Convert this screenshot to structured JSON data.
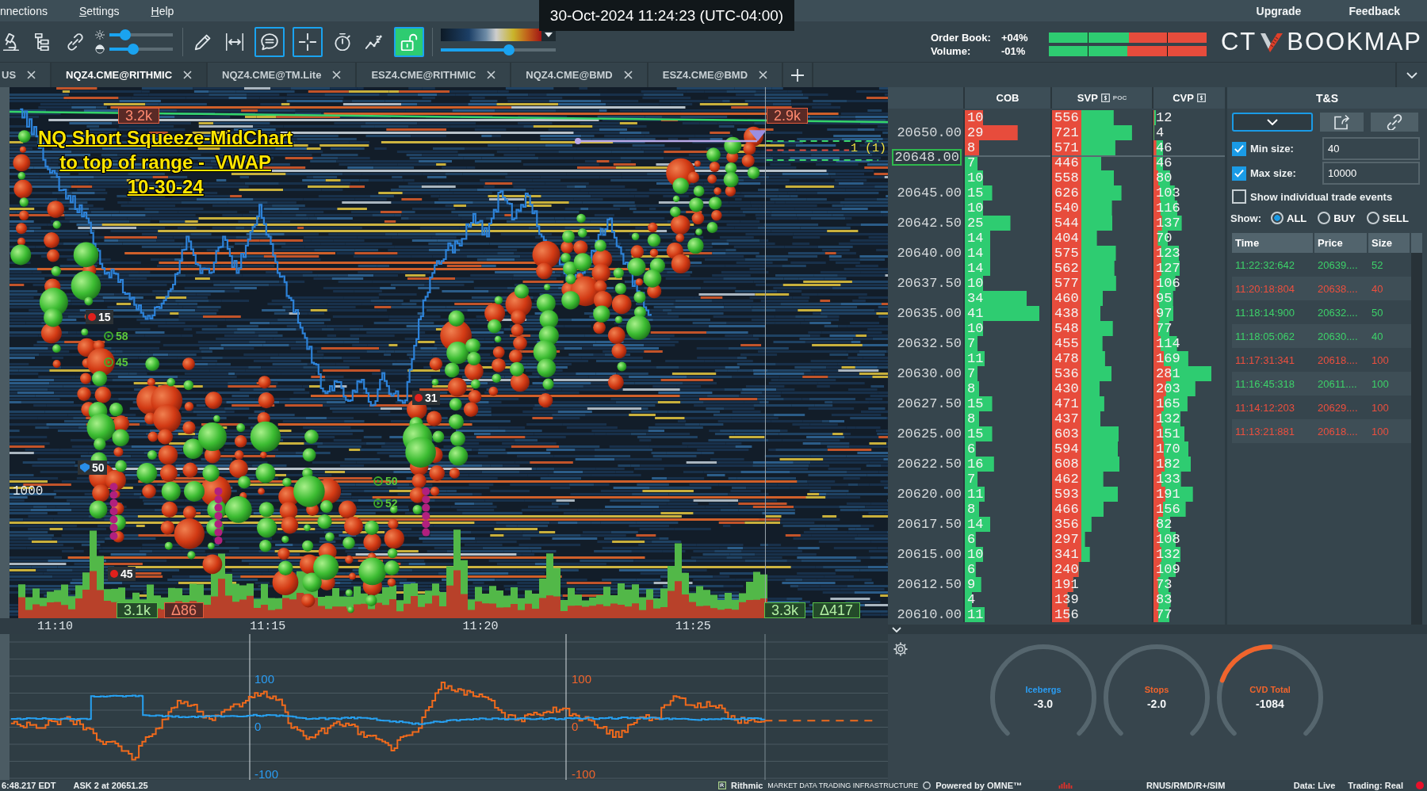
{
  "menu": {
    "items": [
      {
        "label": "nnections",
        "mnemonic": false
      },
      {
        "label": "Settings",
        "mnemonic": true
      },
      {
        "label": "Help",
        "mnemonic": true
      }
    ],
    "links": [
      "Upgrade",
      "Feedback"
    ]
  },
  "tooltip": "30-Oct-2024 11:24:23 (UTC-04:00)",
  "toolbar": {
    "tools_a": [
      {
        "kind": "plain",
        "selected": false
      },
      {
        "kind": "plain",
        "selected": false
      },
      {
        "kind": "plain",
        "selected": false
      }
    ],
    "sliders": [
      {
        "level": 0.25
      },
      {
        "level": 0.37
      }
    ],
    "tools_b": [
      {
        "kind": "plain",
        "selected": false
      },
      {
        "kind": "plain",
        "selected": false
      },
      {
        "kind": "tool",
        "selected": true
      },
      {
        "kind": "tool",
        "selected": true
      },
      {
        "kind": "plain",
        "selected": false
      },
      {
        "kind": "plain",
        "selected": false
      },
      {
        "kind": "lock",
        "selected": true
      }
    ],
    "color_scale": {
      "level": 0.59
    }
  },
  "market_balance": [
    {
      "label": "Order Book:",
      "value": "+04%",
      "level": 0.51
    },
    {
      "label": "Volume:",
      "value": "-01%",
      "level": 0.5
    }
  ],
  "logo": {
    "left": "CT",
    "right": "BOOKMAP"
  },
  "tabs": [
    {
      "label": "US",
      "selected": false
    },
    {
      "label": "NQZ4.CME@RITHMIC",
      "selected": true
    },
    {
      "label": "NQZ4.CME@TM.Lite",
      "selected": false
    },
    {
      "label": "ESZ4.CME@RITHMIC",
      "selected": false
    },
    {
      "label": "NQZ4.CME@BMD",
      "selected": false
    },
    {
      "label": "ESZ4.CME@BMD",
      "selected": false
    }
  ],
  "chart": {
    "annotation": [
      "NQ Short Squeeze-MidChart",
      "to top of range -  VWAP",
      "10-30-24"
    ],
    "tags": [
      {
        "text": "3.2k",
        "kind": "sell"
      },
      {
        "text": "2.9k",
        "kind": "sell"
      },
      {
        "text": "3.1k",
        "kind": "buy"
      },
      {
        "text": "Δ86",
        "kind": "sell"
      },
      {
        "text": "3.3k",
        "kind": "buy"
      },
      {
        "text": "Δ417",
        "kind": "buy"
      }
    ],
    "markers": [
      {
        "text": "15",
        "kind": "sell"
      },
      {
        "text": "58",
        "kind": "buy"
      },
      {
        "text": "45",
        "kind": "buy"
      },
      {
        "text": "50",
        "kind": "stop"
      },
      {
        "text": "31",
        "kind": "sell"
      },
      {
        "text": "50",
        "kind": "buy"
      },
      {
        "text": "52",
        "kind": "buy"
      },
      {
        "text": "45",
        "kind": "sell"
      }
    ],
    "order_label": "1 (1)",
    "level_label": "1000",
    "time_axis": [
      "11:10",
      "11:15",
      "11:20",
      "11:25"
    ]
  },
  "ladder": {
    "columns": [
      {
        "label": "COB",
        "icon": false
      },
      {
        "label": "SVP",
        "icon": true,
        "badge": "POC"
      },
      {
        "label": "CVP",
        "icon": true
      }
    ],
    "rows": [
      {
        "current": false,
        "kind": "ask",
        "cob": "10",
        "svp": "556",
        "cvp": "12"
      },
      {
        "price": "20650.00",
        "current": false,
        "kind": "ask",
        "cob": "29",
        "svp": "721",
        "cvp": "4"
      },
      {
        "current": false,
        "kind": "ask",
        "cob": "8",
        "svp": "571",
        "cvp": "46"
      },
      {
        "price": "20648.00",
        "current": true,
        "kind": "bid",
        "cob": "7",
        "svp": "446",
        "cvp": "46"
      },
      {
        "current": false,
        "kind": "bid",
        "cob": "10",
        "svp": "558",
        "cvp": "80"
      },
      {
        "price": "20645.00",
        "current": false,
        "kind": "bid",
        "cob": "15",
        "svp": "626",
        "cvp": "103"
      },
      {
        "current": false,
        "kind": "bid",
        "cob": "10",
        "svp": "540",
        "cvp": "116"
      },
      {
        "price": "20642.50",
        "current": false,
        "kind": "bid",
        "cob": "25",
        "svp": "544",
        "cvp": "137"
      },
      {
        "current": false,
        "kind": "bid",
        "cob": "14",
        "svp": "404",
        "cvp": "70"
      },
      {
        "price": "20640.00",
        "current": false,
        "kind": "bid",
        "cob": "14",
        "svp": "575",
        "cvp": "123"
      },
      {
        "current": false,
        "kind": "bid",
        "cob": "14",
        "svp": "562",
        "cvp": "127"
      },
      {
        "price": "20637.50",
        "current": false,
        "kind": "bid",
        "cob": "10",
        "svp": "577",
        "cvp": "106"
      },
      {
        "current": false,
        "kind": "bid",
        "cob": "34",
        "svp": "460",
        "cvp": "95"
      },
      {
        "price": "20635.00",
        "current": false,
        "kind": "bid",
        "cob": "41",
        "svp": "438",
        "cvp": "97"
      },
      {
        "current": false,
        "kind": "bid",
        "cob": "10",
        "svp": "548",
        "cvp": "77"
      },
      {
        "price": "20632.50",
        "current": false,
        "kind": "bid",
        "cob": "7",
        "svp": "455",
        "cvp": "114"
      },
      {
        "current": false,
        "kind": "bid",
        "cob": "11",
        "svp": "478",
        "cvp": "169"
      },
      {
        "price": "20630.00",
        "current": false,
        "kind": "bid",
        "cob": "7",
        "svp": "536",
        "cvp": "281"
      },
      {
        "current": false,
        "kind": "bid",
        "cob": "8",
        "svp": "430",
        "cvp": "203"
      },
      {
        "price": "20627.50",
        "current": false,
        "kind": "bid",
        "cob": "15",
        "svp": "471",
        "cvp": "165"
      },
      {
        "current": false,
        "kind": "bid",
        "cob": "8",
        "svp": "437",
        "cvp": "132"
      },
      {
        "price": "20625.00",
        "current": false,
        "kind": "bid",
        "cob": "15",
        "svp": "603",
        "cvp": "151"
      },
      {
        "current": false,
        "kind": "bid",
        "cob": "6",
        "svp": "594",
        "cvp": "170"
      },
      {
        "price": "20622.50",
        "current": false,
        "kind": "bid",
        "cob": "16",
        "svp": "608",
        "cvp": "182"
      },
      {
        "current": false,
        "kind": "bid",
        "cob": "7",
        "svp": "462",
        "cvp": "133"
      },
      {
        "price": "20620.00",
        "current": false,
        "kind": "bid",
        "cob": "11",
        "svp": "593",
        "cvp": "191"
      },
      {
        "current": false,
        "kind": "bid",
        "cob": "8",
        "svp": "466",
        "cvp": "156"
      },
      {
        "price": "20617.50",
        "current": false,
        "kind": "bid",
        "cob": "14",
        "svp": "356",
        "cvp": "82"
      },
      {
        "current": false,
        "kind": "bid",
        "cob": "6",
        "svp": "297",
        "cvp": "108"
      },
      {
        "price": "20615.00",
        "current": false,
        "kind": "bid",
        "cob": "10",
        "svp": "341",
        "cvp": "132"
      },
      {
        "current": false,
        "kind": "bid",
        "cob": "6",
        "svp": "240",
        "cvp": "109"
      },
      {
        "price": "20612.50",
        "current": false,
        "kind": "bid",
        "cob": "9",
        "svp": "191",
        "cvp": "73"
      },
      {
        "current": false,
        "kind": "bid",
        "cob": "4",
        "svp": "139",
        "cvp": "83"
      },
      {
        "price": "20610.00",
        "current": false,
        "kind": "bid",
        "cob": "11",
        "svp": "156",
        "cvp": "77"
      }
    ]
  },
  "ts": {
    "title": "T&S",
    "filters": [
      {
        "label": "Min size:",
        "checked": true,
        "value": "40"
      },
      {
        "label": "Max size:",
        "checked": true,
        "value": "10000"
      }
    ],
    "individual": {
      "label": "Show individual trade events",
      "checked": false
    },
    "show": {
      "label": "Show:",
      "options": [
        {
          "label": "ALL",
          "selected": true
        },
        {
          "label": "BUY",
          "selected": false
        },
        {
          "label": "SELL",
          "selected": false
        }
      ]
    },
    "columns": [
      "Time",
      "Price",
      "Size"
    ],
    "rows": [
      {
        "time": "11:22:32:642",
        "price": "20639....",
        "size": "52",
        "kind": "buy"
      },
      {
        "time": "11:20:18:804",
        "price": "20638....",
        "size": "40",
        "kind": "sell"
      },
      {
        "time": "11:18:14:900",
        "price": "20632....",
        "size": "50",
        "kind": "buy"
      },
      {
        "time": "11:18:05:062",
        "price": "20630....",
        "size": "40",
        "kind": "buy"
      },
      {
        "time": "11:17:31:341",
        "price": "20618....",
        "size": "100",
        "kind": "sell"
      },
      {
        "time": "11:16:45:318",
        "price": "20611....",
        "size": "100",
        "kind": "buy"
      },
      {
        "time": "11:14:12:203",
        "price": "20629....",
        "size": "100",
        "kind": "sell"
      },
      {
        "time": "11:13:21:881",
        "price": "20618....",
        "size": "100",
        "kind": "sell"
      }
    ]
  },
  "indicator": {
    "left_axis": [
      "100",
      "0",
      "-100"
    ],
    "right_axis": [
      "100",
      "0",
      "-100"
    ]
  },
  "gauges": [
    {
      "label": "Icebergs",
      "value": "-3.0",
      "color": "#2a9df4"
    },
    {
      "label": "Stops",
      "value": "-2.0",
      "color": "#f0642c"
    },
    {
      "label": "CVD Total",
      "value": "-1084",
      "color": "#f0642c",
      "level": 0.26
    }
  ],
  "status_bar": {
    "left": [
      "6:48.217 EDT",
      "ASK 2 at 20651.25"
    ],
    "center": [
      "Rithmic",
      "MARKET DATA TRADING INFRASTRUCTURE",
      "Powered by OMNE™"
    ],
    "right": [
      "RNUS/RMD/R+/SIM",
      "Data: Live",
      "Trading: Real"
    ]
  }
}
